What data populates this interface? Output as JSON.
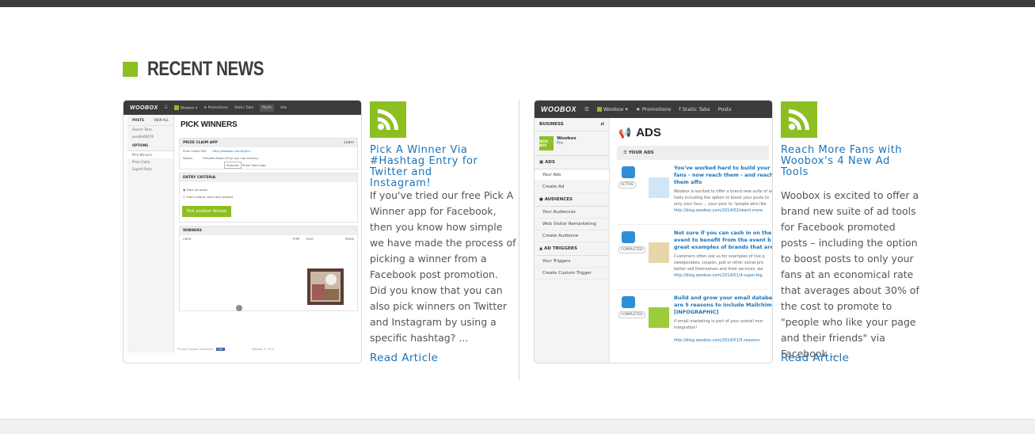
{
  "section": {
    "title": "RECENT NEWS"
  },
  "colors": {
    "accent": "#8cc022",
    "link": "#1a73b8",
    "topbar": "#3d3d3d"
  },
  "articles": [
    {
      "title": "Pick A Winner Via #Hashtag Entry for Twitter and Instagram!",
      "body": "If you've tried our free Pick A Winner app for Facebook, then you know how simple we have made the process of picking a winner from a Facebook post promotion. Did you know that you can also pick winners on Twitter and Instagram by using a specific hashtag? ...",
      "link": "Read Article",
      "icon": "rss-icon",
      "screenshot": {
        "logo": "WOOBOX",
        "nav": [
          "Woobox ▾",
          "Promotions",
          "Static Tabs",
          "Posts",
          "Ads"
        ],
        "sidebar_head": "POSTS",
        "sidebar_view_all": "VIEW ALL",
        "sidebar_search": "Search Term",
        "sidebar_user": "punkteit0074",
        "sidebar_options": "OPTIONS",
        "sidebar_items": [
          "Pick Winners",
          "Prize Claim",
          "Export Posts"
        ],
        "heading": "PICK WINNERS",
        "prize_claim": "PRIZE CLAIM APP",
        "prize_claim_more": "Learn",
        "claim_url_label": "Prize Claim URL",
        "claim_url": "http://woobox.com/5g5cv",
        "status_label": "Status",
        "status_value": "Preview Mode (Only you can access)",
        "activate": "Activate",
        "claim_app": "Prize Claim App",
        "entry_criteria": "ENTRY CRITERIA",
        "option_all": "From all posts",
        "option_unique": "From unique users who posted",
        "pick_button": "Pick another Winner",
        "winners": "WINNERS",
        "col_user": "USER",
        "col_type": "TYPE",
        "col_text": "TEXT",
        "col_prize": "PRIZE",
        "footer": "Privacy   Support   Facebook",
        "footer_like": "Like",
        "footer_copy": "Woobox © 2014"
      }
    },
    {
      "title": "Reach More Fans with Woobox's 4 New Ad Tools",
      "body": "Woobox is excited to offer a brand new suite of ad tools for Facebook promoted posts – including the option to boost posts to only your fans at an economical rate that averages about 30% of the cost to promote to \"people who like your page and their friends\" via Facebook ...",
      "link": "Read Article",
      "icon": "rss-icon",
      "screenshot": {
        "logo": "WOOBOX",
        "nav": [
          "Woobox ▾",
          "Promotions",
          "Static Tabs",
          "Posts"
        ],
        "business": "BUSINESS",
        "brand_logo": "WOO BOX",
        "brand_name": "Woobox",
        "brand_plan": "Pro",
        "sec_ads": "ADS",
        "ads_items": [
          "Your Ads",
          "Create Ad"
        ],
        "sec_audiences": "AUDIENCES",
        "aud_items": [
          "Your Audiences",
          "Web Visitor Remarketing",
          "Create Audience"
        ],
        "sec_triggers": "AD TRIGGERS",
        "trig_items": [
          "Your Triggers",
          "Create Custom Trigger"
        ],
        "heading": "ADS",
        "your_ads": "YOUR ADS",
        "ads": [
          {
            "status": "ACTIVE",
            "title": "You've worked hard to build your fans - now reach them - and reach them affo",
            "desc": "Woobox is excited to offer a brand new suite of ad tools including the option to boost your posts to only your fans ... your post to \"people who like your page and",
            "link": "http://blog.woobox.com/2014/02/reach-more"
          },
          {
            "status": "COMPLETED",
            "title": "Not sure if you can cash in on the event to benefit from the event b great examples of brands that are",
            "desc": "Customers often ask us for examples of live p sweepstakes, coupon, poll or other social pro better sell themselves and their services, we",
            "link": "http://blog.woobox.com/2014/01/4-super-big"
          },
          {
            "status": "COMPLETED",
            "title": "Build and grow your email databa are 5 reasons to include Mailchim [INFOGRAPHIC]",
            "desc": "If email marketing is part of your overall mar integration!",
            "link": "http://blog.woobox.com/2014/01/5-reasons-"
          }
        ]
      }
    }
  ]
}
